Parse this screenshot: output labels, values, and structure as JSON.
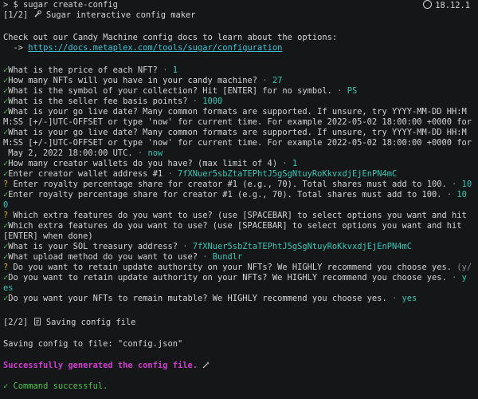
{
  "prompt": {
    "symbol": ">",
    "command": "$ sugar create-config"
  },
  "version": "18.12.1",
  "step1": {
    "tag": "[1/2]",
    "title": "Sugar interactive config maker"
  },
  "intro": {
    "text": "Check out our Candy Machine config docs to learn about the options:",
    "arrow": "->",
    "url": "https://docs.metaplex.com/tools/sugar/configuration"
  },
  "check": "✓",
  "qmark": "?",
  "dot": "·",
  "answers": {
    "price": "1",
    "count": "27",
    "symbol": "PS",
    "fee": "1000",
    "golive": "now",
    "wallets": "1",
    "wallet1": "7fXNuer5sbZtaTEPhtJ5gSgNtuyRoKkvxdjEjEnPN4mC",
    "royalty_a": "10",
    "royalty_b": "10",
    "royalty_c": "0",
    "treasury": "7fXNuer5sbZtaTEPhtJ5gSgNtuyRoKkvxdjEjEnPN4mC",
    "upload": "Bundlr",
    "retain_a": "(y/",
    "retain_b": "y",
    "retain_c": "es",
    "mutable": "yes"
  },
  "questions": {
    "price": "What is the price of each NFT?",
    "count": "How many NFTs will you have in your candy machine?",
    "symbol": "What is the symbol of your collection? Hit [ENTER] for no symbol.",
    "fee": "What is the seller fee basis points?",
    "golive1_a": "What is your go live date? Many common formats are supported. If unsure, try YYYY-MM-DD HH:M",
    "golive1_b": "M:SS [+/-]UTC-OFFSET or type 'now' for current time. For example 2022-05-02 18:00:00 +0000 for",
    "golive2_a": "What is your go live date? Many common formats are supported. If unsure, try YYYY-MM-DD HH:M",
    "golive2_b": "M:SS [+/-]UTC-OFFSET or type 'now' for current time. For example 2022-05-02 18:00:00 +0000 for",
    "golive2_c": " May 2, 2022 18:00:00 UTC.",
    "wallets": "How many creator wallets do you have? (max limit of 4)",
    "wallet1": "Enter creator wallet address #1",
    "royalty1": "Enter royalty percentage share for creator #1 (e.g., 70). Total shares must add to 100.",
    "royalty2": "Enter royalty percentage share for creator #1 (e.g., 70). Total shares must add to 100.",
    "features1": "Which extra features do you want to use? (use [SPACEBAR] to select options you want and hit",
    "features2_a": "Which extra features do you want to use? (use [SPACEBAR] to select options you want and hit",
    "features2_b": "[ENTER] when done)",
    "treasury": "What is your SOL treasury address?",
    "upload": "What upload method do you want to use?",
    "retain1": "Do you want to retain update authority on your NFTs? We HIGHLY recommend you choose yes.",
    "retain2": "Do you want to retain update authority on your NFTs? We HIGHLY recommend you choose yes.",
    "mutable": "Do you want your NFTs to remain mutable? We HIGHLY recommend you choose yes."
  },
  "step2": {
    "tag": "[2/2]",
    "title": "Saving config file"
  },
  "saving": "Saving config to file: \"config.json\"",
  "success": "Successfully generated the config file.",
  "done": "Command successful.",
  "colors": {
    "check": "#4fc14f",
    "question": "#d9a93b",
    "answer": "#39c6b5",
    "success": "#cf3fd0",
    "link": "#3fc4d6"
  }
}
